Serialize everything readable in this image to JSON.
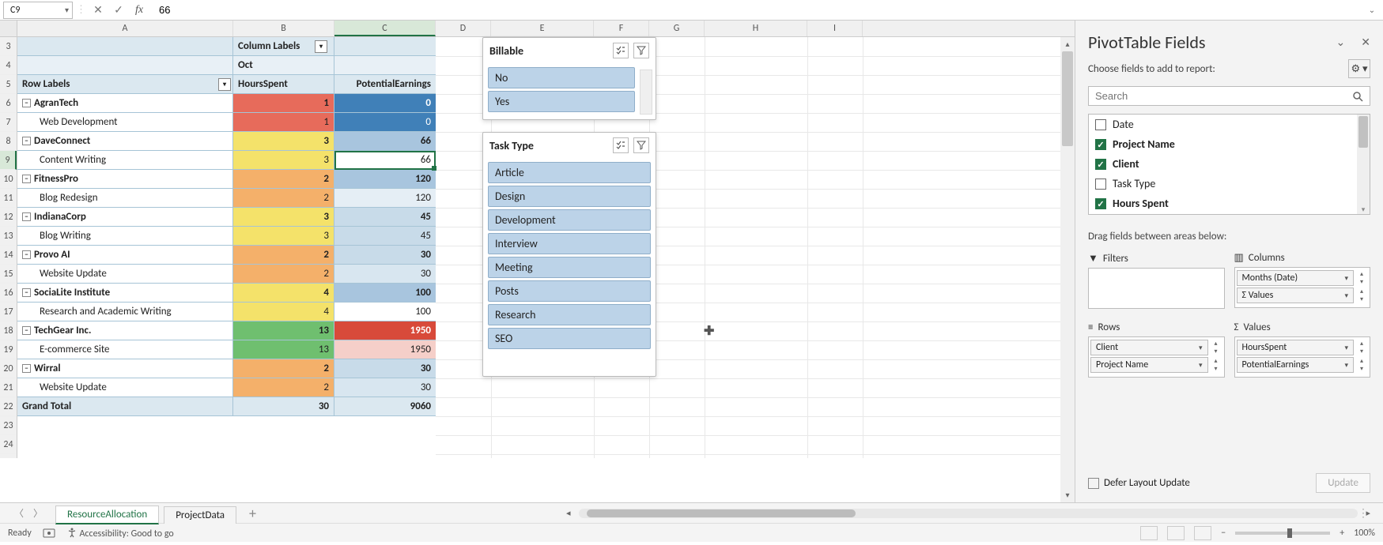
{
  "formula_bar": {
    "cell_ref": "C9",
    "value": "66"
  },
  "columns": [
    "A",
    "B",
    "C",
    "D",
    "E",
    "F",
    "G",
    "H",
    "I"
  ],
  "row_numbers": [
    3,
    4,
    5,
    6,
    7,
    8,
    9,
    10,
    11,
    12,
    13,
    14,
    15,
    16,
    17,
    18,
    19,
    20,
    21,
    22,
    23,
    24
  ],
  "pivot": {
    "col_labels_title": "Column Labels",
    "month": "Oct",
    "row_labels_title": "Row Labels",
    "val1_header": "HoursSpent",
    "val2_header": "PotentialEarnings",
    "rows": [
      {
        "label": "AgranTech",
        "group": true,
        "hours": "1",
        "earn": "0",
        "cB": "bg-red",
        "cC": "bg-blue1"
      },
      {
        "label": "Web Development",
        "group": false,
        "hours": "1",
        "earn": "0",
        "cB": "bg-red",
        "cC": "bg-blue1"
      },
      {
        "label": "DaveConnect",
        "group": true,
        "hours": "3",
        "earn": "66",
        "cB": "bg-yellow",
        "cC": "bg-blue2"
      },
      {
        "label": "Content Writing",
        "group": false,
        "hours": "3",
        "earn": "66",
        "cB": "bg-yellow",
        "cC": "bg-white"
      },
      {
        "label": "FitnessPro",
        "group": true,
        "hours": "2",
        "earn": "120",
        "cB": "bg-orange",
        "cC": "bg-blue2"
      },
      {
        "label": "Blog Redesign",
        "group": false,
        "hours": "2",
        "earn": "120",
        "cB": "bg-orange",
        "cC": "bg-blue5"
      },
      {
        "label": "IndianaCorp",
        "group": true,
        "hours": "3",
        "earn": "45",
        "cB": "bg-yellow",
        "cC": "bg-blue3"
      },
      {
        "label": "Blog Writing",
        "group": false,
        "hours": "3",
        "earn": "45",
        "cB": "bg-yellow",
        "cC": "bg-blue3"
      },
      {
        "label": "Provo AI",
        "group": true,
        "hours": "2",
        "earn": "30",
        "cB": "bg-orange",
        "cC": "bg-blue3"
      },
      {
        "label": "Website Update",
        "group": false,
        "hours": "2",
        "earn": "30",
        "cB": "bg-orange",
        "cC": "bg-blue4"
      },
      {
        "label": "SociaLite Institute",
        "group": true,
        "hours": "4",
        "earn": "100",
        "cB": "bg-yellow",
        "cC": "bg-blue2"
      },
      {
        "label": "Research and Academic Writing",
        "group": false,
        "hours": "4",
        "earn": "100",
        "cB": "bg-yellow",
        "cC": "bg-white"
      },
      {
        "label": "TechGear Inc.",
        "group": true,
        "hours": "13",
        "earn": "1950",
        "cB": "bg-green",
        "cC": "bg-reddk"
      },
      {
        "label": "E-commerce Site",
        "group": false,
        "hours": "13",
        "earn": "1950",
        "cB": "bg-green",
        "cC": "bg-pink"
      },
      {
        "label": "Wirral",
        "group": true,
        "hours": "2",
        "earn": "30",
        "cB": "bg-orange",
        "cC": "bg-blue3"
      },
      {
        "label": "Website Update",
        "group": false,
        "hours": "2",
        "earn": "30",
        "cB": "bg-orange",
        "cC": "bg-blue4"
      }
    ],
    "grand_total_label": "Grand Total",
    "grand_hours": "30",
    "grand_earn": "9060"
  },
  "slicers": {
    "billable": {
      "title": "Billable",
      "items": [
        "No",
        "Yes"
      ]
    },
    "tasktype": {
      "title": "Task Type",
      "items": [
        "Article",
        "Design",
        "Development",
        "Interview",
        "Meeting",
        "Posts",
        "Research",
        "SEO"
      ]
    }
  },
  "task_pane": {
    "title": "PivotTable Fields",
    "subtitle": "Choose fields to add to report:",
    "search_placeholder": "Search",
    "fields": [
      {
        "name": "Date",
        "checked": false,
        "bold": false
      },
      {
        "name": "Project Name",
        "checked": true,
        "bold": true
      },
      {
        "name": "Client",
        "checked": true,
        "bold": true
      },
      {
        "name": "Task Type",
        "checked": false,
        "bold": false
      },
      {
        "name": "Hours Spent",
        "checked": true,
        "bold": true
      }
    ],
    "drag_label": "Drag fields between areas below:",
    "areas": {
      "filters": {
        "title": "Filters",
        "items": []
      },
      "columns": {
        "title": "Columns",
        "items": [
          "Months (Date)",
          "Σ Values"
        ]
      },
      "rows": {
        "title": "Rows",
        "items": [
          "Client",
          "Project Name"
        ]
      },
      "values": {
        "title": "Σ  Values",
        "items": [
          "HoursSpent",
          "PotentialEarnings"
        ]
      }
    },
    "defer_label": "Defer Layout Update",
    "update_btn": "Update"
  },
  "sheet_tabs": {
    "tabs": [
      "ResourceAllocation",
      "ProjectData"
    ],
    "active": 0
  },
  "status": {
    "ready": "Ready",
    "access": "Accessibility: Good to go",
    "zoom": "100%"
  }
}
